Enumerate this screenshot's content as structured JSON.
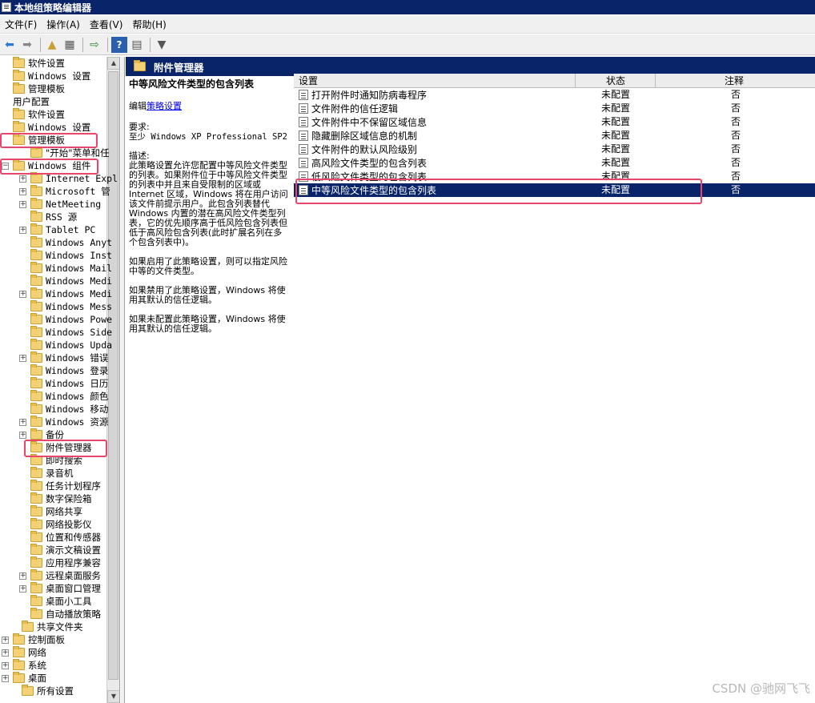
{
  "window": {
    "title": "本地组策略编辑器"
  },
  "menu": [
    "文件(F)",
    "操作(A)",
    "查看(V)",
    "帮助(H)"
  ],
  "toolbar": [
    "back-icon",
    "forward-icon",
    "up-folder-icon",
    "show-tree-icon",
    "export-icon",
    "help-icon",
    "properties-icon",
    "filter-icon"
  ],
  "tree": [
    {
      "label": "软件设置",
      "indent": 0,
      "exp": "",
      "mono": false
    },
    {
      "label": "Windows 设置",
      "indent": 0,
      "exp": "",
      "mono": true
    },
    {
      "label": "管理模板",
      "indent": 0,
      "exp": "",
      "mono": false
    },
    {
      "label": "用户配置",
      "indent": 0,
      "exp": "",
      "mono": false,
      "nofolder": true
    },
    {
      "label": "软件设置",
      "indent": 0,
      "exp": "",
      "mono": false
    },
    {
      "label": "Windows 设置",
      "indent": 0,
      "exp": "",
      "mono": true
    },
    {
      "label": "管理模板",
      "indent": 0,
      "exp": "",
      "mono": false
    },
    {
      "label": "\"开始\"菜单和任",
      "indent": 1,
      "exp": "",
      "mono": false
    },
    {
      "label": "Windows 组件",
      "indent": 0,
      "exp": "−",
      "mono": true
    },
    {
      "label": "Internet Expl",
      "indent": 1,
      "exp": "+",
      "mono": true
    },
    {
      "label": "Microsoft 管",
      "indent": 1,
      "exp": "+",
      "mono": true
    },
    {
      "label": "NetMeeting",
      "indent": 1,
      "exp": "+",
      "mono": true
    },
    {
      "label": "RSS 源",
      "indent": 1,
      "exp": "",
      "mono": true
    },
    {
      "label": "Tablet PC",
      "indent": 1,
      "exp": "+",
      "mono": true
    },
    {
      "label": "Windows Anyt",
      "indent": 1,
      "exp": "",
      "mono": true
    },
    {
      "label": "Windows Inst",
      "indent": 1,
      "exp": "",
      "mono": true
    },
    {
      "label": "Windows Mail",
      "indent": 1,
      "exp": "",
      "mono": true
    },
    {
      "label": "Windows Medi",
      "indent": 1,
      "exp": "",
      "mono": true
    },
    {
      "label": "Windows Medi",
      "indent": 1,
      "exp": "+",
      "mono": true
    },
    {
      "label": "Windows Mess",
      "indent": 1,
      "exp": "",
      "mono": true
    },
    {
      "label": "Windows Powe",
      "indent": 1,
      "exp": "",
      "mono": true
    },
    {
      "label": "Windows Side",
      "indent": 1,
      "exp": "",
      "mono": true
    },
    {
      "label": "Windows Upda",
      "indent": 1,
      "exp": "",
      "mono": true
    },
    {
      "label": "Windows 错误",
      "indent": 1,
      "exp": "+",
      "mono": true
    },
    {
      "label": "Windows 登录",
      "indent": 1,
      "exp": "",
      "mono": true
    },
    {
      "label": "Windows 日历",
      "indent": 1,
      "exp": "",
      "mono": true
    },
    {
      "label": "Windows 颜色",
      "indent": 1,
      "exp": "",
      "mono": true
    },
    {
      "label": "Windows 移动",
      "indent": 1,
      "exp": "",
      "mono": true
    },
    {
      "label": "Windows 资源",
      "indent": 1,
      "exp": "+",
      "mono": true
    },
    {
      "label": "备份",
      "indent": 1,
      "exp": "+",
      "mono": false
    },
    {
      "label": "附件管理器",
      "indent": 1,
      "exp": "",
      "mono": false
    },
    {
      "label": "即时搜索",
      "indent": 1,
      "exp": "",
      "mono": false
    },
    {
      "label": "录音机",
      "indent": 1,
      "exp": "",
      "mono": false
    },
    {
      "label": "任务计划程序",
      "indent": 1,
      "exp": "",
      "mono": false
    },
    {
      "label": "数字保险箱",
      "indent": 1,
      "exp": "",
      "mono": false
    },
    {
      "label": "网络共享",
      "indent": 1,
      "exp": "",
      "mono": false
    },
    {
      "label": "网络投影仪",
      "indent": 1,
      "exp": "",
      "mono": false
    },
    {
      "label": "位置和传感器",
      "indent": 1,
      "exp": "",
      "mono": false
    },
    {
      "label": "演示文稿设置",
      "indent": 1,
      "exp": "",
      "mono": false
    },
    {
      "label": "应用程序兼容",
      "indent": 1,
      "exp": "",
      "mono": false
    },
    {
      "label": "远程桌面服务",
      "indent": 1,
      "exp": "+",
      "mono": false
    },
    {
      "label": "桌面窗口管理",
      "indent": 1,
      "exp": "+",
      "mono": false
    },
    {
      "label": "桌面小工具",
      "indent": 1,
      "exp": "",
      "mono": false
    },
    {
      "label": "自动播放策略",
      "indent": 1,
      "exp": "",
      "mono": false
    },
    {
      "label": "共享文件夹",
      "indent": 0.5,
      "exp": "",
      "mono": false
    },
    {
      "label": "控制面板",
      "indent": 0,
      "exp": "+",
      "mono": false
    },
    {
      "label": "网络",
      "indent": 0,
      "exp": "+",
      "mono": false
    },
    {
      "label": "系统",
      "indent": 0,
      "exp": "+",
      "mono": false
    },
    {
      "label": "桌面",
      "indent": 0,
      "exp": "+",
      "mono": false
    },
    {
      "label": "所有设置",
      "indent": 0.5,
      "exp": "",
      "mono": false
    }
  ],
  "panel": {
    "title": "附件管理器"
  },
  "desc": {
    "title": "中等风险文件类型的包含列表",
    "edit_prefix": "编辑",
    "edit_link": "策略设置",
    "req_label": "要求:",
    "req_text": "至少 Windows XP Professional SP2",
    "desc_label": "描述:",
    "desc_text": "此策略设置允许您配置中等风险文件类型的列表。如果附件位于中等风险文件类型的列表中并且来自受限制的区域或 Internet 区域，Windows 将在用户访问该文件前提示用户。此包含列表替代 Windows 内置的潜在高风险文件类型列表，它的优先顺序高于低风险包含列表但低于高风险包含列表(此时扩展名列在多个包含列表中)。",
    "p_enabled": "如果启用了此策略设置，则可以指定风险中等的文件类型。",
    "p_disabled": "如果禁用了此策略设置，Windows 将使用其默认的信任逻辑。",
    "p_notconf": "如果未配置此策略设置，Windows 将使用其默认的信任逻辑。"
  },
  "list": {
    "columns": [
      "设置",
      "状态",
      "注释"
    ],
    "rows": [
      {
        "name": "打开附件时通知防病毒程序",
        "state": "未配置",
        "note": "否"
      },
      {
        "name": "文件附件的信任逻辑",
        "state": "未配置",
        "note": "否"
      },
      {
        "name": "文件附件中不保留区域信息",
        "state": "未配置",
        "note": "否"
      },
      {
        "name": "隐藏删除区域信息的机制",
        "state": "未配置",
        "note": "否"
      },
      {
        "name": "文件附件的默认风险级别",
        "state": "未配置",
        "note": "否"
      },
      {
        "name": "高风险文件类型的包含列表",
        "state": "未配置",
        "note": "否"
      },
      {
        "name": "低风险文件类型的包含列表",
        "state": "未配置",
        "note": "否"
      },
      {
        "name": "中等风险文件类型的包含列表",
        "state": "未配置",
        "note": "否"
      }
    ],
    "selected_index": 7
  },
  "watermark": "CSDN @驰网飞飞",
  "colors": {
    "titlebar": "#0a246a",
    "highlight": "#e8466a",
    "folder": "#f3d276"
  }
}
